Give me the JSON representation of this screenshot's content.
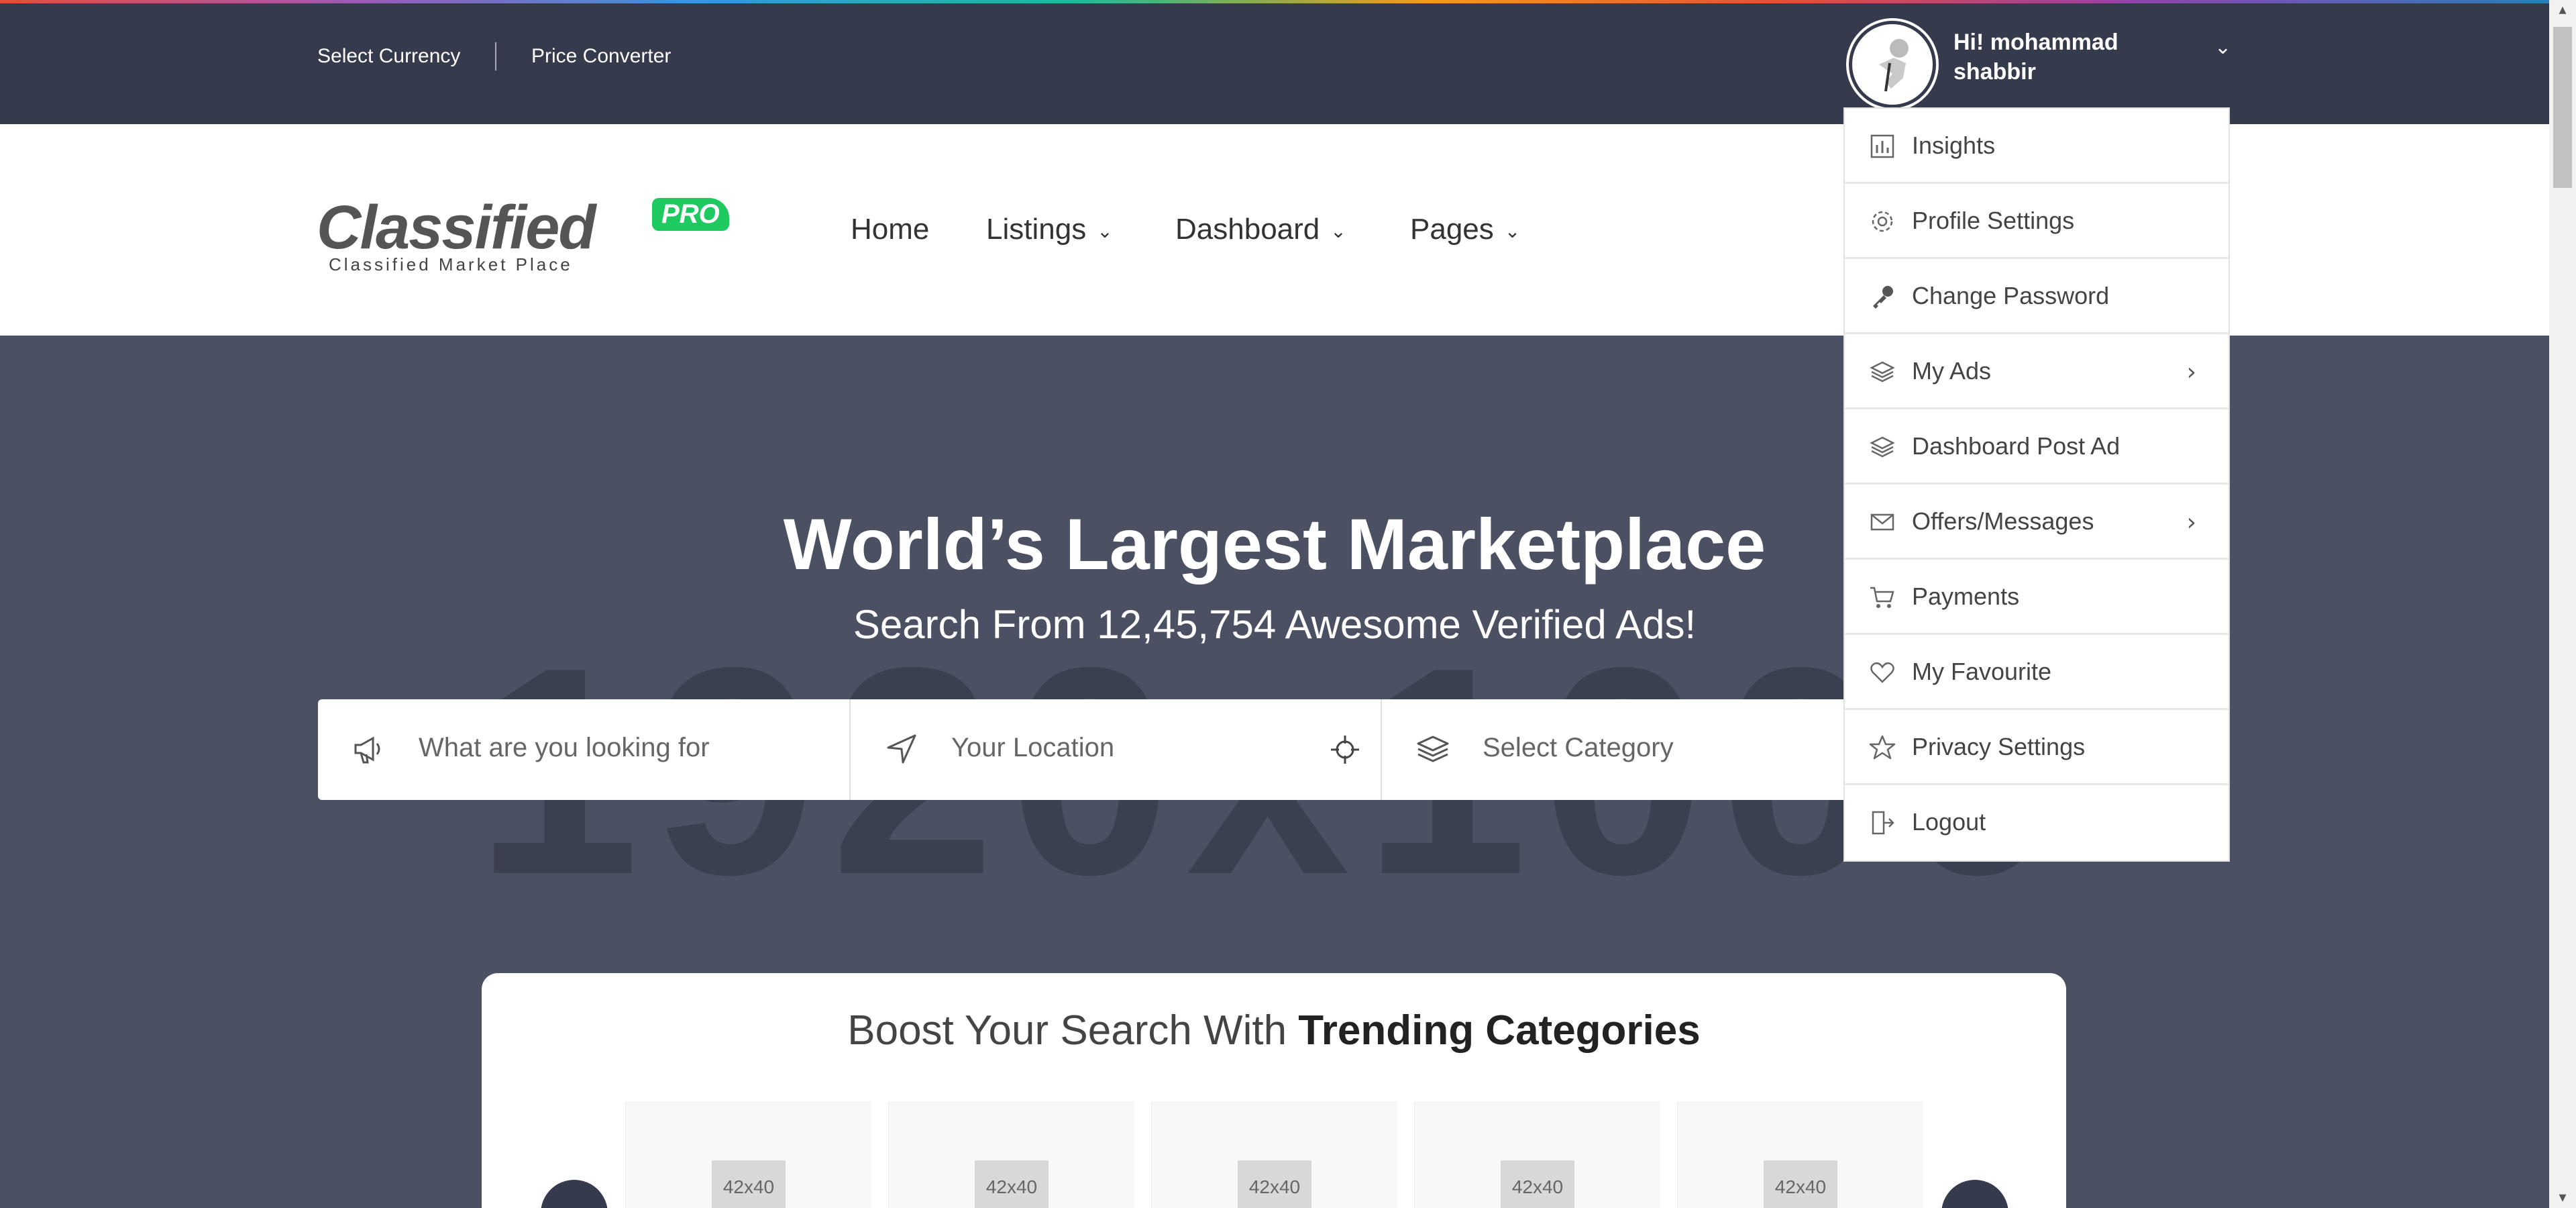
{
  "topbar": {
    "select_currency": "Select Currency",
    "price_converter": "Price Converter",
    "greeting": "Hi! mohammad shabbir"
  },
  "logo": {
    "word": "Classified",
    "badge": "PRO",
    "tagline": "Classified Market Place"
  },
  "nav": {
    "items": [
      "Home",
      "Listings",
      "Dashboard",
      "Pages"
    ]
  },
  "hero": {
    "title": "World’s Largest Marketplace",
    "subtitle": "Search From 12,45,754 Awesome Verified Ads!",
    "watermark": "1920x1000"
  },
  "search": {
    "keyword_placeholder": "What are you looking for",
    "location_placeholder": "Your Location",
    "category_placeholder": "Select Category"
  },
  "user_menu": {
    "items": [
      {
        "label": "Insights",
        "icon": "chart-icon"
      },
      {
        "label": "Profile Settings",
        "icon": "gear-icon"
      },
      {
        "label": "Change Password",
        "icon": "key-icon"
      },
      {
        "label": "My Ads",
        "icon": "layers-icon"
      },
      {
        "label": "Dashboard Post Ad",
        "icon": "layers-icon"
      },
      {
        "label": "Offers/Messages",
        "icon": "envelope-icon"
      },
      {
        "label": "Payments",
        "icon": "cart-icon"
      },
      {
        "label": "My Favourite",
        "icon": "heart-icon"
      },
      {
        "label": "Privacy Settings",
        "icon": "star-icon"
      },
      {
        "label": "Logout",
        "icon": "logout-icon"
      }
    ]
  },
  "trending": {
    "title_light": "Boost Your Search With",
    "title_bold": "Trending Categories",
    "placeholders": [
      "42x40",
      "42x40",
      "42x40",
      "42x40",
      "42x40"
    ]
  },
  "colors": {
    "topbar": "#353a4d",
    "hero_bg": "#4b5162",
    "accent_green": "#1ec95f"
  }
}
